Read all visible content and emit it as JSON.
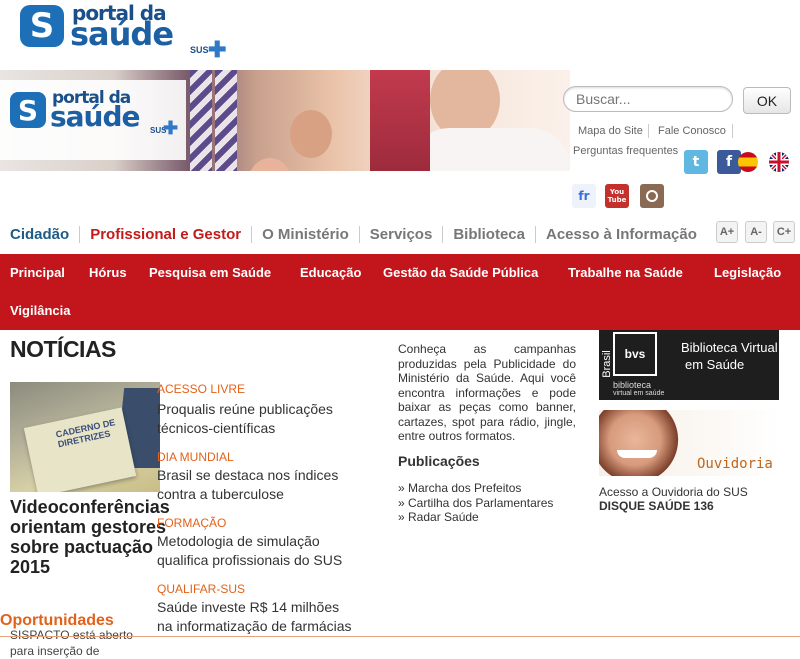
{
  "brand": {
    "logo_word1": "portal da",
    "logo_word2": "saúde",
    "logo_sus": "SUS",
    "logo_letter": "S"
  },
  "search": {
    "placeholder": "Buscar...",
    "button_label": "OK"
  },
  "top_links": {
    "site_map": "Mapa do Site",
    "contact": "Fale Conosco",
    "faq": "Perguntas frequentes"
  },
  "social": {
    "twitter": "t",
    "facebook": "f",
    "flickr": "fr",
    "youtube": "You Tube",
    "instagram": "ig"
  },
  "nav_primary": [
    {
      "label": "Cidadão"
    },
    {
      "label": "Profissional e Gestor"
    },
    {
      "label": "O Ministério"
    },
    {
      "label": "Serviços"
    },
    {
      "label": "Biblioteca"
    },
    {
      "label": "Acesso à Informação"
    }
  ],
  "font_controls": {
    "increase": "A+",
    "decrease": "A-",
    "contrast": "C+"
  },
  "nav_secondary": [
    {
      "label": "Principal"
    },
    {
      "label": "Hórus"
    },
    {
      "label": "Pesquisa em Saúde"
    },
    {
      "label": "Educação"
    },
    {
      "label": "Gestão da Saúde Pública"
    },
    {
      "label": "Trabalhe na Saúde"
    },
    {
      "label": "Legislação"
    },
    {
      "label": "Vigilância"
    }
  ],
  "news": {
    "heading": "NOTÍCIAS",
    "thumb_caption": "CADERNO DE DIRETRIZES",
    "lead_title": "Videoconferências orientam gestores sobre pactuação 2015",
    "lead_text": "SISPACTO está aberto para inserção de",
    "items": [
      {
        "category": "ACESSO LIVRE",
        "title": "Proqualis reúne publicações técnicos-científicas"
      },
      {
        "category": "DIA MUNDIAL",
        "title": "Brasil se destaca nos índices contra a tuberculose"
      },
      {
        "category": "FORMAÇÃO",
        "title": "Metodologia de simulação qualifica profissionais do SUS"
      },
      {
        "category": "QUALIFAR-SUS",
        "title": "Saúde investe R$ 14 milhões na informatização de farmácias"
      }
    ]
  },
  "campaigns": {
    "text": "Conheça as campanhas produzidas pela Publicidade do Ministério da Saúde. Aqui você encontra informações e pode baixar as peças como banner, cartazes, spot para rádio, jingle, entre outros formatos.",
    "publications_heading": "Publicações",
    "publications": [
      {
        "label": "» Marcha dos Prefeitos"
      },
      {
        "label": "» Cartilha dos Parlamentares"
      },
      {
        "label": "» Radar Saúde"
      }
    ]
  },
  "sidebar": {
    "bvs_label1": "Biblioteca Virtual",
    "bvs_label2": "em Saúde",
    "bvs_small1": "biblioteca",
    "bvs_small2": "virtual em saúde",
    "bvs_vertical": "Brasil",
    "bvs_mark": "bvs",
    "ouvidoria_label": "Ouvidoria",
    "ouvidoria_text": "Acesso a Ouvidoria do SUS",
    "disque": "DISQUE SAÚDE 136"
  },
  "opportunities": {
    "heading": "Oportunidades"
  },
  "colors": {
    "brand_blue": "#1d6fb8",
    "nav_red": "#c3151c",
    "accent_orange": "#e2621b",
    "active_red": "#c41a1a"
  }
}
